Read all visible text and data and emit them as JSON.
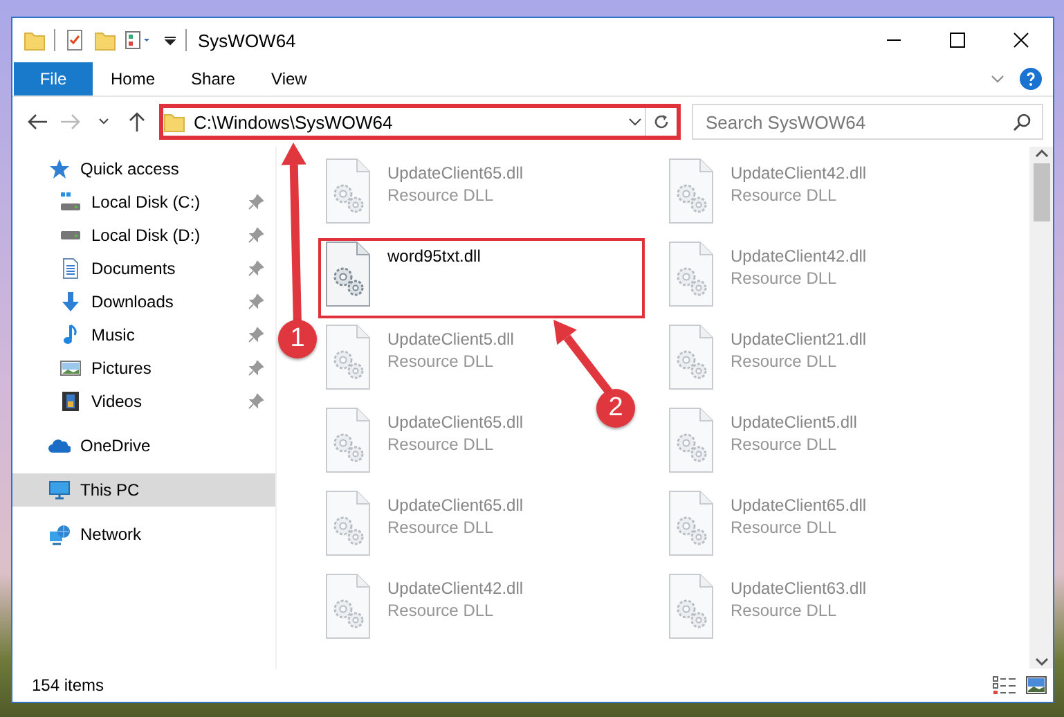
{
  "window": {
    "title": "SysWOW64"
  },
  "ribbon": {
    "tabs": [
      {
        "label": "File",
        "kind": "backstage",
        "selected": false
      },
      {
        "label": "Home",
        "kind": "tab",
        "selected": false
      },
      {
        "label": "Share",
        "kind": "tab",
        "selected": false
      },
      {
        "label": "View",
        "kind": "tab",
        "selected": false
      }
    ]
  },
  "address_bar": {
    "path": "C:\\Windows\\SysWOW64",
    "highlighted": true
  },
  "search": {
    "placeholder": "Search SysWOW64"
  },
  "navigation": {
    "items": [
      {
        "label": "Quick access",
        "kind": "star",
        "selected": false,
        "pinned": false,
        "children": [
          {
            "label": "Local Disk (C:)",
            "kind": "system-drive",
            "selected": false,
            "pinned": true
          },
          {
            "label": "Local Disk (D:)",
            "kind": "drive",
            "selected": false,
            "pinned": true
          },
          {
            "label": "Documents",
            "kind": "documents",
            "selected": false,
            "pinned": true
          },
          {
            "label": "Downloads",
            "kind": "downloads",
            "selected": false,
            "pinned": true
          },
          {
            "label": "Music",
            "kind": "music",
            "selected": false,
            "pinned": true
          },
          {
            "label": "Pictures",
            "kind": "pictures",
            "selected": false,
            "pinned": true
          },
          {
            "label": "Videos",
            "kind": "videos",
            "selected": false,
            "pinned": true
          }
        ]
      },
      {
        "label": "OneDrive",
        "kind": "cloud",
        "selected": false,
        "pinned": false
      },
      {
        "label": "This PC",
        "kind": "computer",
        "selected": true,
        "pinned": false
      },
      {
        "label": "Network",
        "kind": "network",
        "selected": false,
        "pinned": false
      }
    ]
  },
  "files": {
    "items": [
      {
        "name": "UpdateClient65.dll",
        "type": "Resource DLL",
        "blurred": true,
        "highlighted": false
      },
      {
        "name": "UpdateClient42.dll",
        "type": "Resource DLL",
        "blurred": true,
        "highlighted": false
      },
      {
        "name": "word95txt.dll",
        "blurred": false,
        "highlighted": true
      },
      {
        "name": "UpdateClient42.dll",
        "type": "Resource DLL",
        "blurred": true,
        "highlighted": false
      },
      {
        "name": "UpdateClient5.dll",
        "type": "Resource DLL",
        "blurred": true,
        "highlighted": false
      },
      {
        "name": "UpdateClient21.dll",
        "type": "Resource DLL",
        "blurred": true,
        "highlighted": false
      },
      {
        "name": "UpdateClient65.dll",
        "type": "Resource DLL",
        "blurred": true,
        "highlighted": false
      },
      {
        "name": "UpdateClient5.dll",
        "type": "Resource DLL",
        "blurred": true,
        "highlighted": false
      },
      {
        "name": "UpdateClient65.dll",
        "type": "Resource DLL",
        "blurred": true,
        "highlighted": false
      },
      {
        "name": "UpdateClient65.dll",
        "type": "Resource DLL",
        "blurred": true,
        "highlighted": false
      },
      {
        "name": "UpdateClient42.dll",
        "type": "Resource DLL",
        "blurred": true,
        "highlighted": false
      },
      {
        "name": "UpdateClient63.dll",
        "type": "Resource DLL",
        "blurred": true,
        "highlighted": false
      }
    ]
  },
  "status_bar": {
    "count": "154 items"
  },
  "callouts": [
    {
      "number": "1"
    },
    {
      "number": "2"
    }
  ]
}
